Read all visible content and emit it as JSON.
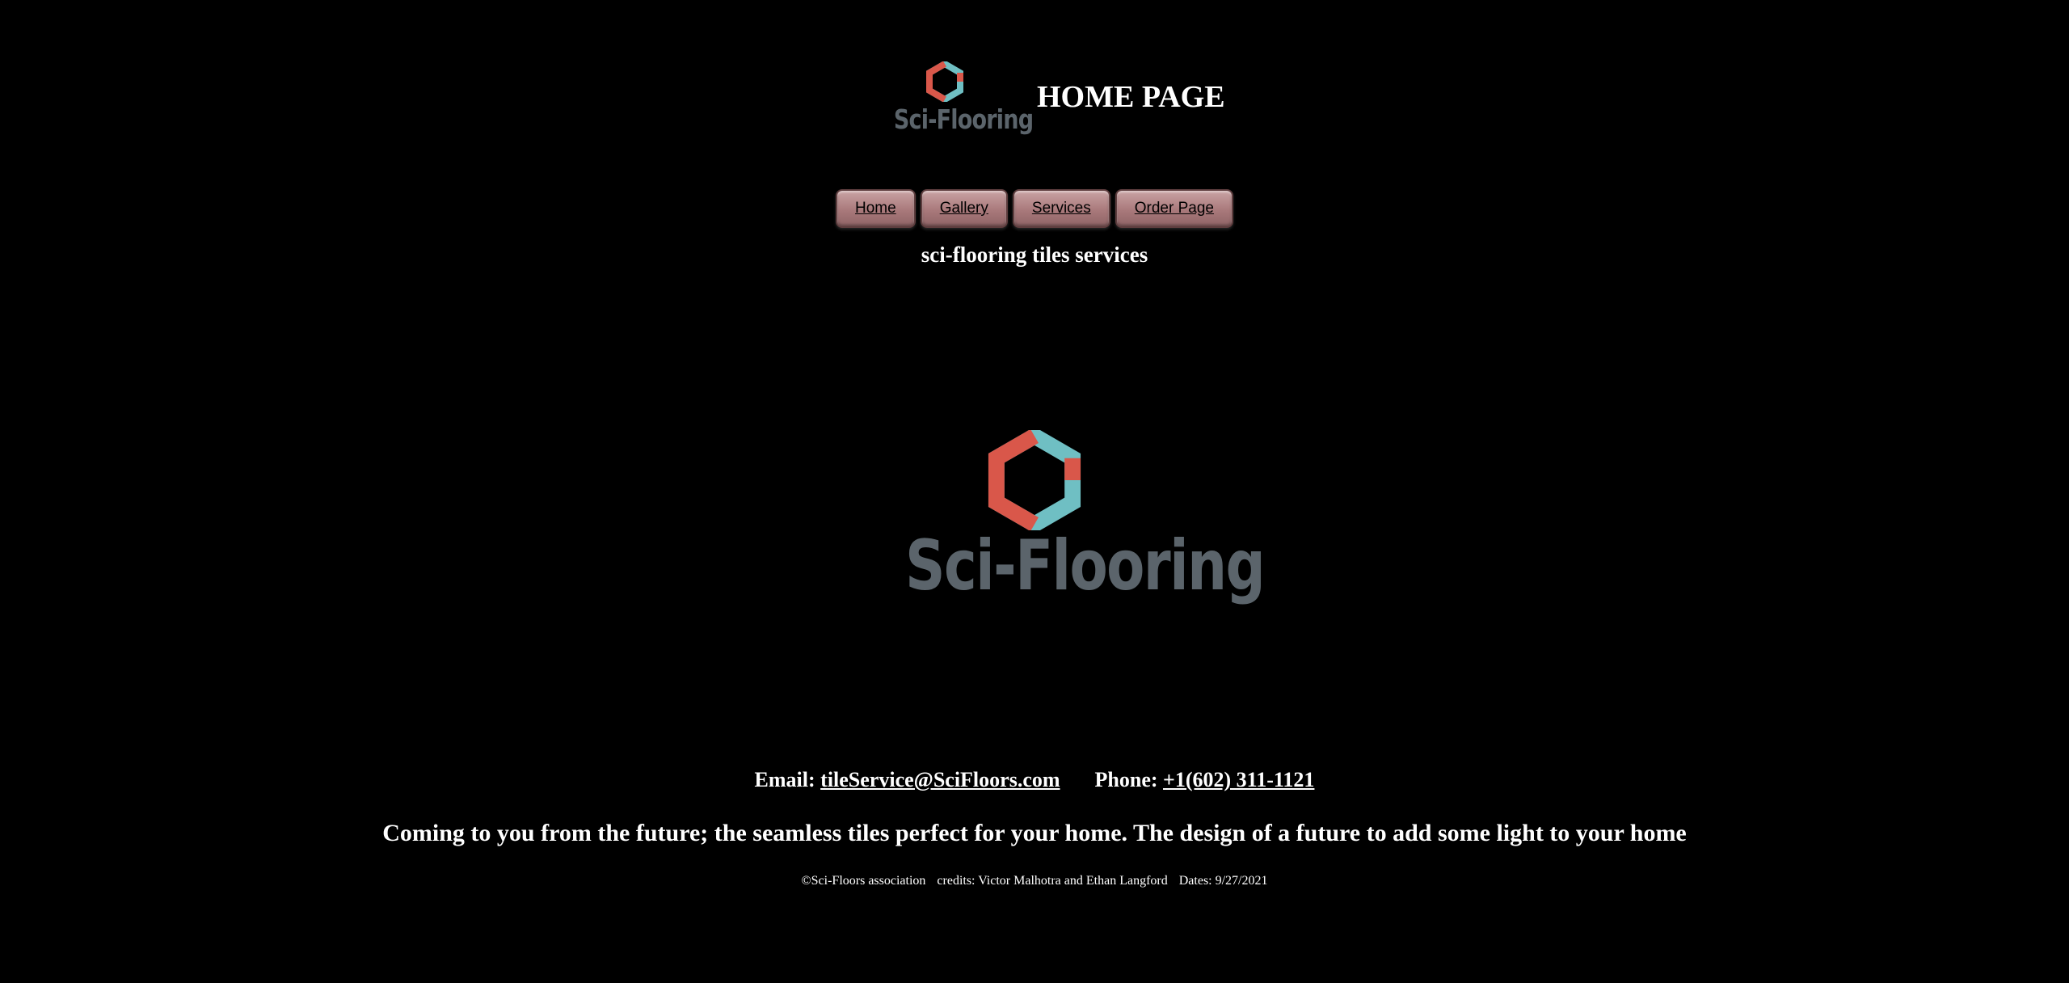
{
  "header": {
    "logo_text": "Sci-Flooring",
    "title": "HOME PAGE"
  },
  "nav": {
    "items": [
      {
        "label": "Home"
      },
      {
        "label": "Gallery"
      },
      {
        "label": "Services"
      },
      {
        "label": "Order Page"
      }
    ]
  },
  "subtitle": "sci-flooring tiles services",
  "main_logo": {
    "text": "Sci-Flooring"
  },
  "contact": {
    "email_label": "Email:",
    "email": "tileService@SciFloors.com",
    "phone_label": "Phone:",
    "phone": "+1(602) 311-1121"
  },
  "tagline": "Coming to you from the future; the seamless tiles perfect for your home. The design of a future to add some light to your home",
  "footer": {
    "copyright": "©Sci-Floors association",
    "credits": "credits: Victor Malhotra and Ethan Langford",
    "dates": "Dates: 9/27/2021"
  },
  "colors": {
    "background": "#000000",
    "logo_teal": "#6fbfc3",
    "logo_red": "#d9574a",
    "logo_text": "#5b646b",
    "button": "#a9797b"
  }
}
